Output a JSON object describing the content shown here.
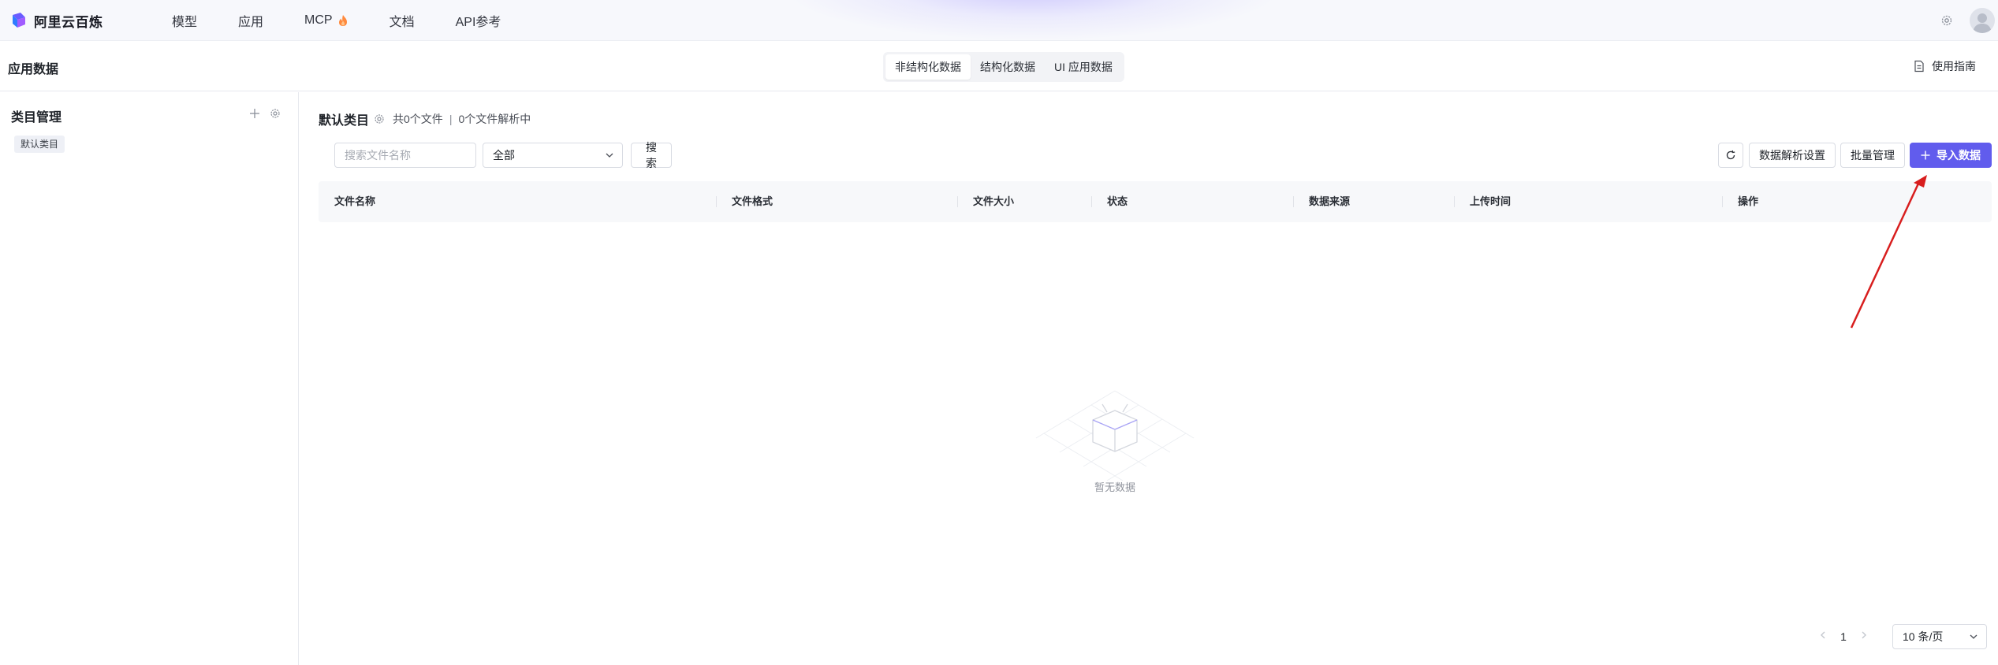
{
  "topnav": {
    "brand": "阿里云百炼",
    "items": [
      {
        "label": "模型"
      },
      {
        "label": "应用"
      },
      {
        "label": "MCP",
        "badge_icon": "flame-icon"
      },
      {
        "label": "文档"
      },
      {
        "label": "API参考"
      }
    ]
  },
  "subheader": {
    "title": "应用数据",
    "tabs": [
      {
        "label": "非结构化数据",
        "active": true
      },
      {
        "label": "结构化数据",
        "active": false
      },
      {
        "label": "UI 应用数据",
        "active": false
      }
    ],
    "guide_label": "使用指南"
  },
  "sidebar": {
    "title": "类目管理",
    "categories": [
      "默认类目"
    ]
  },
  "main": {
    "category_title": "默认类目",
    "file_count": "共0个文件",
    "parsing_count": "0个文件解析中",
    "separator": "|",
    "search_placeholder": "搜索文件名称",
    "filter_value": "全部",
    "search_button": "搜索",
    "parse_settings_button": "数据解析设置",
    "batch_button": "批量管理",
    "import_button": "导入数据",
    "columns": [
      "文件名称",
      "文件格式",
      "文件大小",
      "状态",
      "数据来源",
      "上传时间",
      "操作"
    ],
    "empty_text": "暂无数据",
    "pagination": {
      "current_page": "1",
      "page_size": "10 条/页"
    }
  },
  "colors": {
    "primary": "#615ced",
    "annotation_arrow": "#d81e1e"
  }
}
